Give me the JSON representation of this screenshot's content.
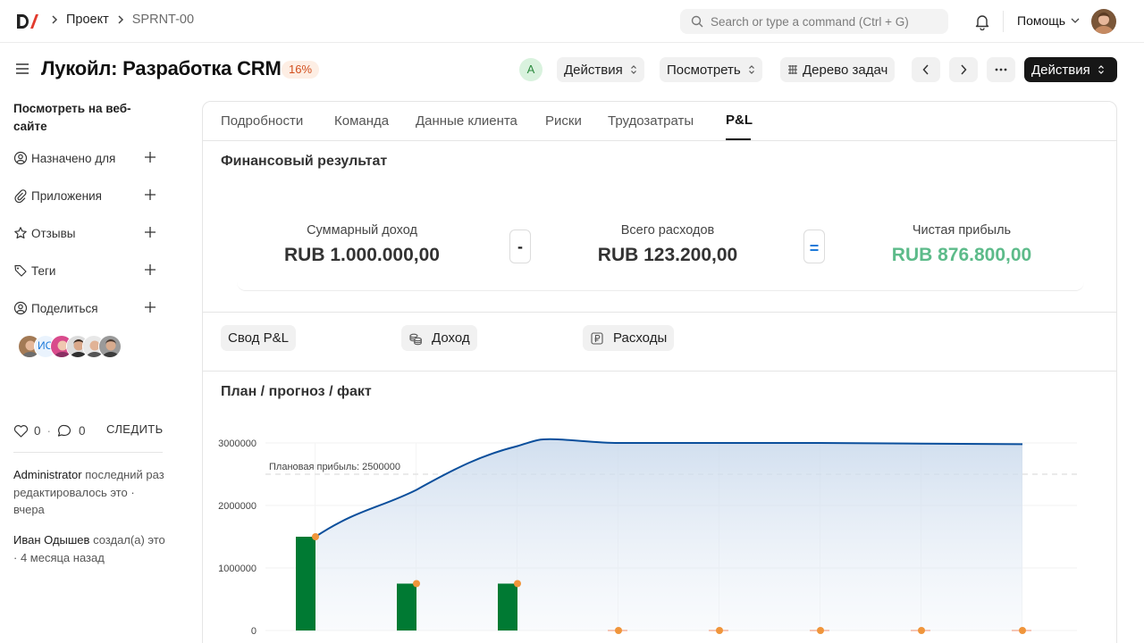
{
  "topnav": {
    "breadcrumbs": [
      "Проект",
      "SPRNT-00"
    ],
    "search_placeholder": "Search or type a command (Ctrl + G)",
    "help_label": "Помощь"
  },
  "header": {
    "title": "Лукойл: Разработка CRM",
    "progress_badge": "16%",
    "progress_value": 16,
    "assignee_initial": "A",
    "actions_label": "Действия",
    "view_label": "Посмотреть",
    "task_tree_label": "Дерево задач",
    "primary_actions_label": "Действия"
  },
  "sidebar": {
    "view_website": "Посмотреть на веб-сайте",
    "items": [
      {
        "label": "Назначено для",
        "icon": "user-circle-icon"
      },
      {
        "label": "Приложения",
        "icon": "paperclip-icon"
      },
      {
        "label": "Отзывы",
        "icon": "star-icon"
      },
      {
        "label": "Теги",
        "icon": "tag-icon"
      },
      {
        "label": "Поделиться",
        "icon": "user-circle-icon"
      }
    ],
    "avatar_initials": "ИО",
    "likes_count": "0",
    "comments_count": "0",
    "follow_label": "СЛЕДИТЬ",
    "activity": [
      {
        "user": "Administrator",
        "text": "последний раз редактировалось это · вчера"
      },
      {
        "user": "Иван Одышев",
        "text": "создал(а) это · 4 месяца назад"
      }
    ]
  },
  "tabs": [
    "Подробности",
    "Команда",
    "Данные клиента",
    "Риски",
    "Трудозатраты",
    "P&L"
  ],
  "active_tab": "P&L",
  "financial": {
    "title": "Финансовый результат",
    "income_label": "Суммарный доход",
    "income_value": "RUB 1.000.000,00",
    "minus_sign": "-",
    "expense_label": "Всего расходов",
    "expense_value": "RUB 123.200,00",
    "equals_sign": "=",
    "profit_label": "Чистая прибыль",
    "profit_value": "RUB 876.800,00"
  },
  "pl_buttons": {
    "summary": "Свод P&L",
    "income": "Доход",
    "expenses": "Расходы"
  },
  "colors": {
    "accent_green": "#5dbb8a",
    "bar_green": "#007a33",
    "line_blue": "#0b4f9c",
    "dot_orange": "#f0953b",
    "badge_orange": "#d24f1e"
  },
  "chart_data": {
    "type": "bar",
    "title": "План / прогноз / факт",
    "ylim": [
      0,
      3000000
    ],
    "yticks": [
      0,
      1000000,
      2000000,
      3000000
    ],
    "grid": true,
    "annotation": "Плановая прибыль: 2500000",
    "plan_profit": 2500000,
    "periods": 8,
    "bars": [
      1500000,
      750000,
      750000,
      0,
      0,
      0,
      0,
      0
    ],
    "line": [
      1500000,
      2250000,
      2950000,
      3000000,
      3000000,
      3000000,
      2990000,
      2980000
    ],
    "line_peak": 3060000,
    "dots": [
      1500000,
      750000,
      750000,
      0,
      0,
      0,
      0,
      0
    ]
  }
}
